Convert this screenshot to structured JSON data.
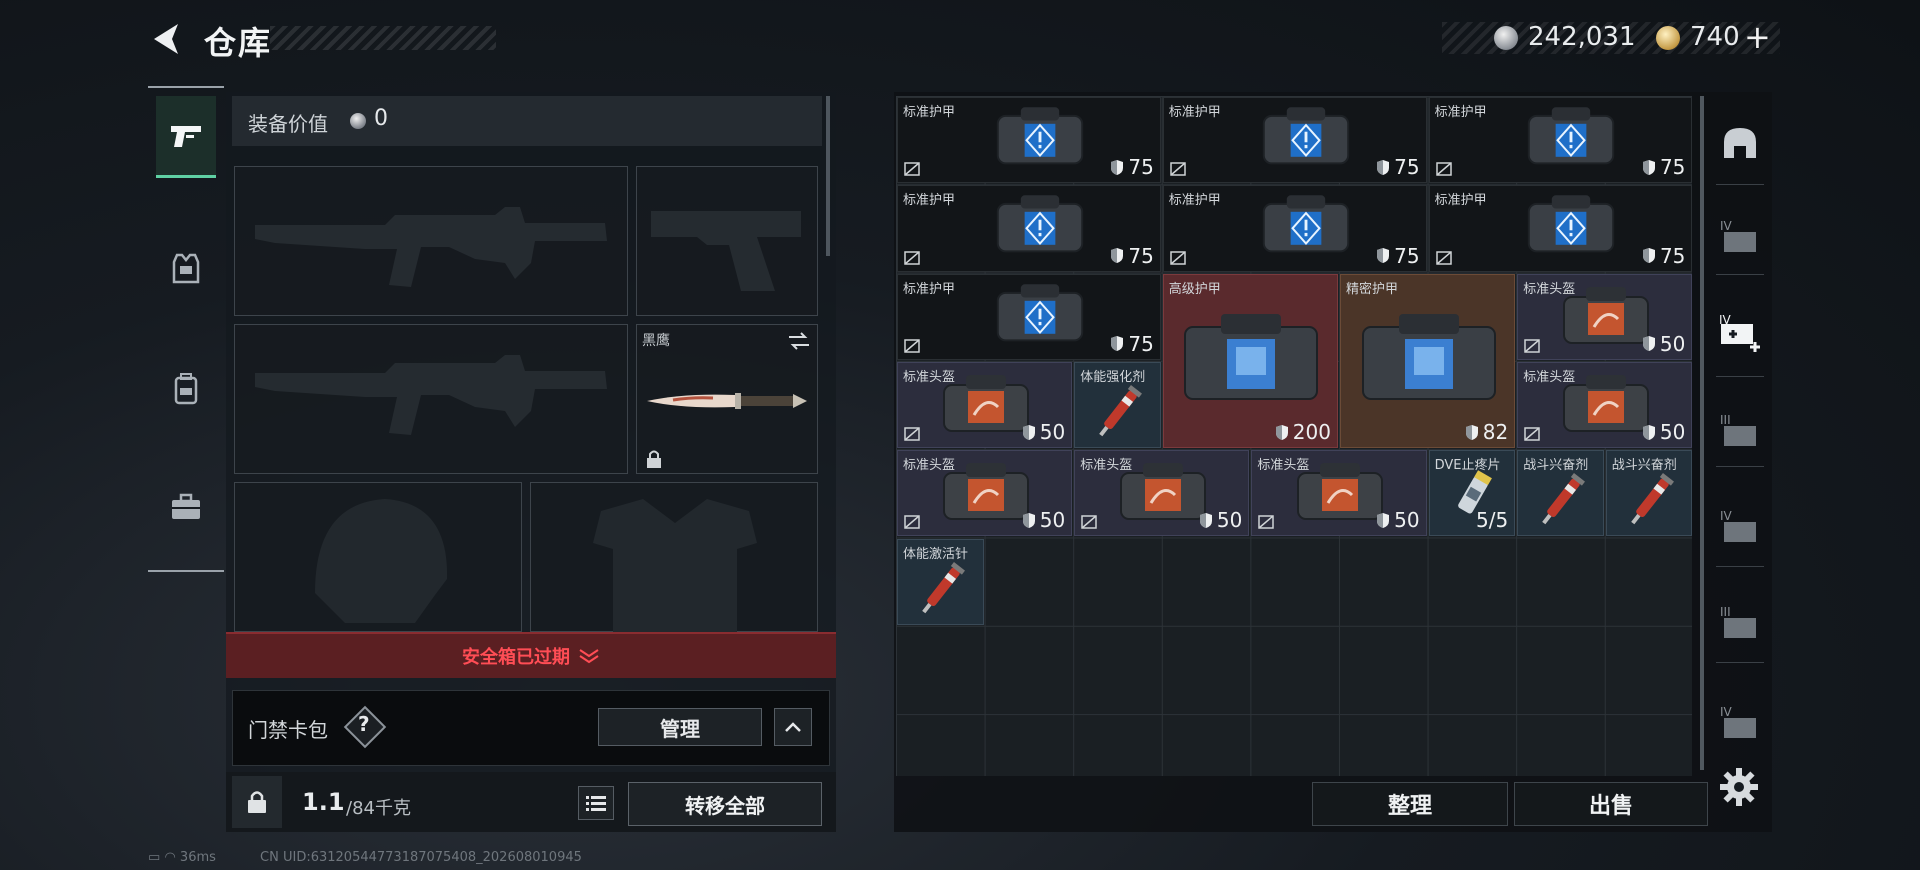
{
  "header": {
    "title": "仓库",
    "silver_amount": "242,031",
    "gold_amount": "740",
    "plus_label": "+"
  },
  "left_rail": {
    "tabs": [
      {
        "icon": "pistol-icon",
        "active": true
      },
      {
        "icon": "armor-vest-icon",
        "active": false
      },
      {
        "icon": "backpack-icon",
        "active": false
      },
      {
        "icon": "briefcase-icon",
        "active": false
      }
    ]
  },
  "loadout": {
    "equip_value_label": "装备价值",
    "equip_value": "0",
    "knife_name": "黑鹰",
    "safe_box_status": "安全箱已过期",
    "keycard_label": "门禁卡包",
    "help_label": "?",
    "manage_label": "管理",
    "weight_current": "1.1",
    "weight_max": "/84千克",
    "transfer_all_label": "转移全部"
  },
  "inventory": {
    "items": [
      {
        "name": "标准护甲",
        "value": "75",
        "type": "armor"
      },
      {
        "name": "标准护甲",
        "value": "75",
        "type": "armor"
      },
      {
        "name": "标准护甲",
        "value": "75",
        "type": "armor"
      },
      {
        "name": "标准护甲",
        "value": "75",
        "type": "armor"
      },
      {
        "name": "标准护甲",
        "value": "75",
        "type": "armor"
      },
      {
        "name": "标准护甲",
        "value": "75",
        "type": "armor"
      },
      {
        "name": "标准护甲",
        "value": "75",
        "type": "armor"
      },
      {
        "name": "高级护甲",
        "value": "200",
        "type": "armor-red"
      },
      {
        "name": "精密护甲",
        "value": "82",
        "type": "armor-orange"
      },
      {
        "name": "标准头盔",
        "value": "50",
        "type": "helmet"
      },
      {
        "name": "标准头盔",
        "value": "50",
        "type": "helmet"
      },
      {
        "name": "体能强化剂",
        "value": "",
        "type": "syringe"
      },
      {
        "name": "标准头盔",
        "value": "50",
        "type": "helmet"
      },
      {
        "name": "标准头盔",
        "value": "50",
        "type": "helmet"
      },
      {
        "name": "标准头盔",
        "value": "50",
        "type": "helmet"
      },
      {
        "name": "标准头盔",
        "value": "50",
        "type": "helmet"
      },
      {
        "name": "DVE止疼片",
        "value": "5/5",
        "type": "pills"
      },
      {
        "name": "战斗兴奋剂",
        "value": "",
        "type": "syringe"
      },
      {
        "name": "战斗兴奋剂",
        "value": "",
        "type": "syringe"
      },
      {
        "name": "体能激活针",
        "value": "",
        "type": "syringe"
      }
    ],
    "sort_label": "整理",
    "sell_label": "出售"
  },
  "right_rail": {
    "items": [
      "helmet-rail-icon",
      "container-iv-icon",
      "container-iv-add-icon",
      "container-iii-icon",
      "container-iv-b-icon",
      "container-iii-b-icon",
      "container-iv-c-icon"
    ]
  },
  "status": {
    "ping": "36ms",
    "uid": "CN UID:63120544773187075408_202608010945"
  },
  "colors": {
    "accent_green": "#5fd1a4",
    "alert_red": "#ff4d55",
    "high_tier": "#5a2a2d",
    "mid_tier": "#4b3528",
    "helmet_tier": "#2c2d3d"
  }
}
